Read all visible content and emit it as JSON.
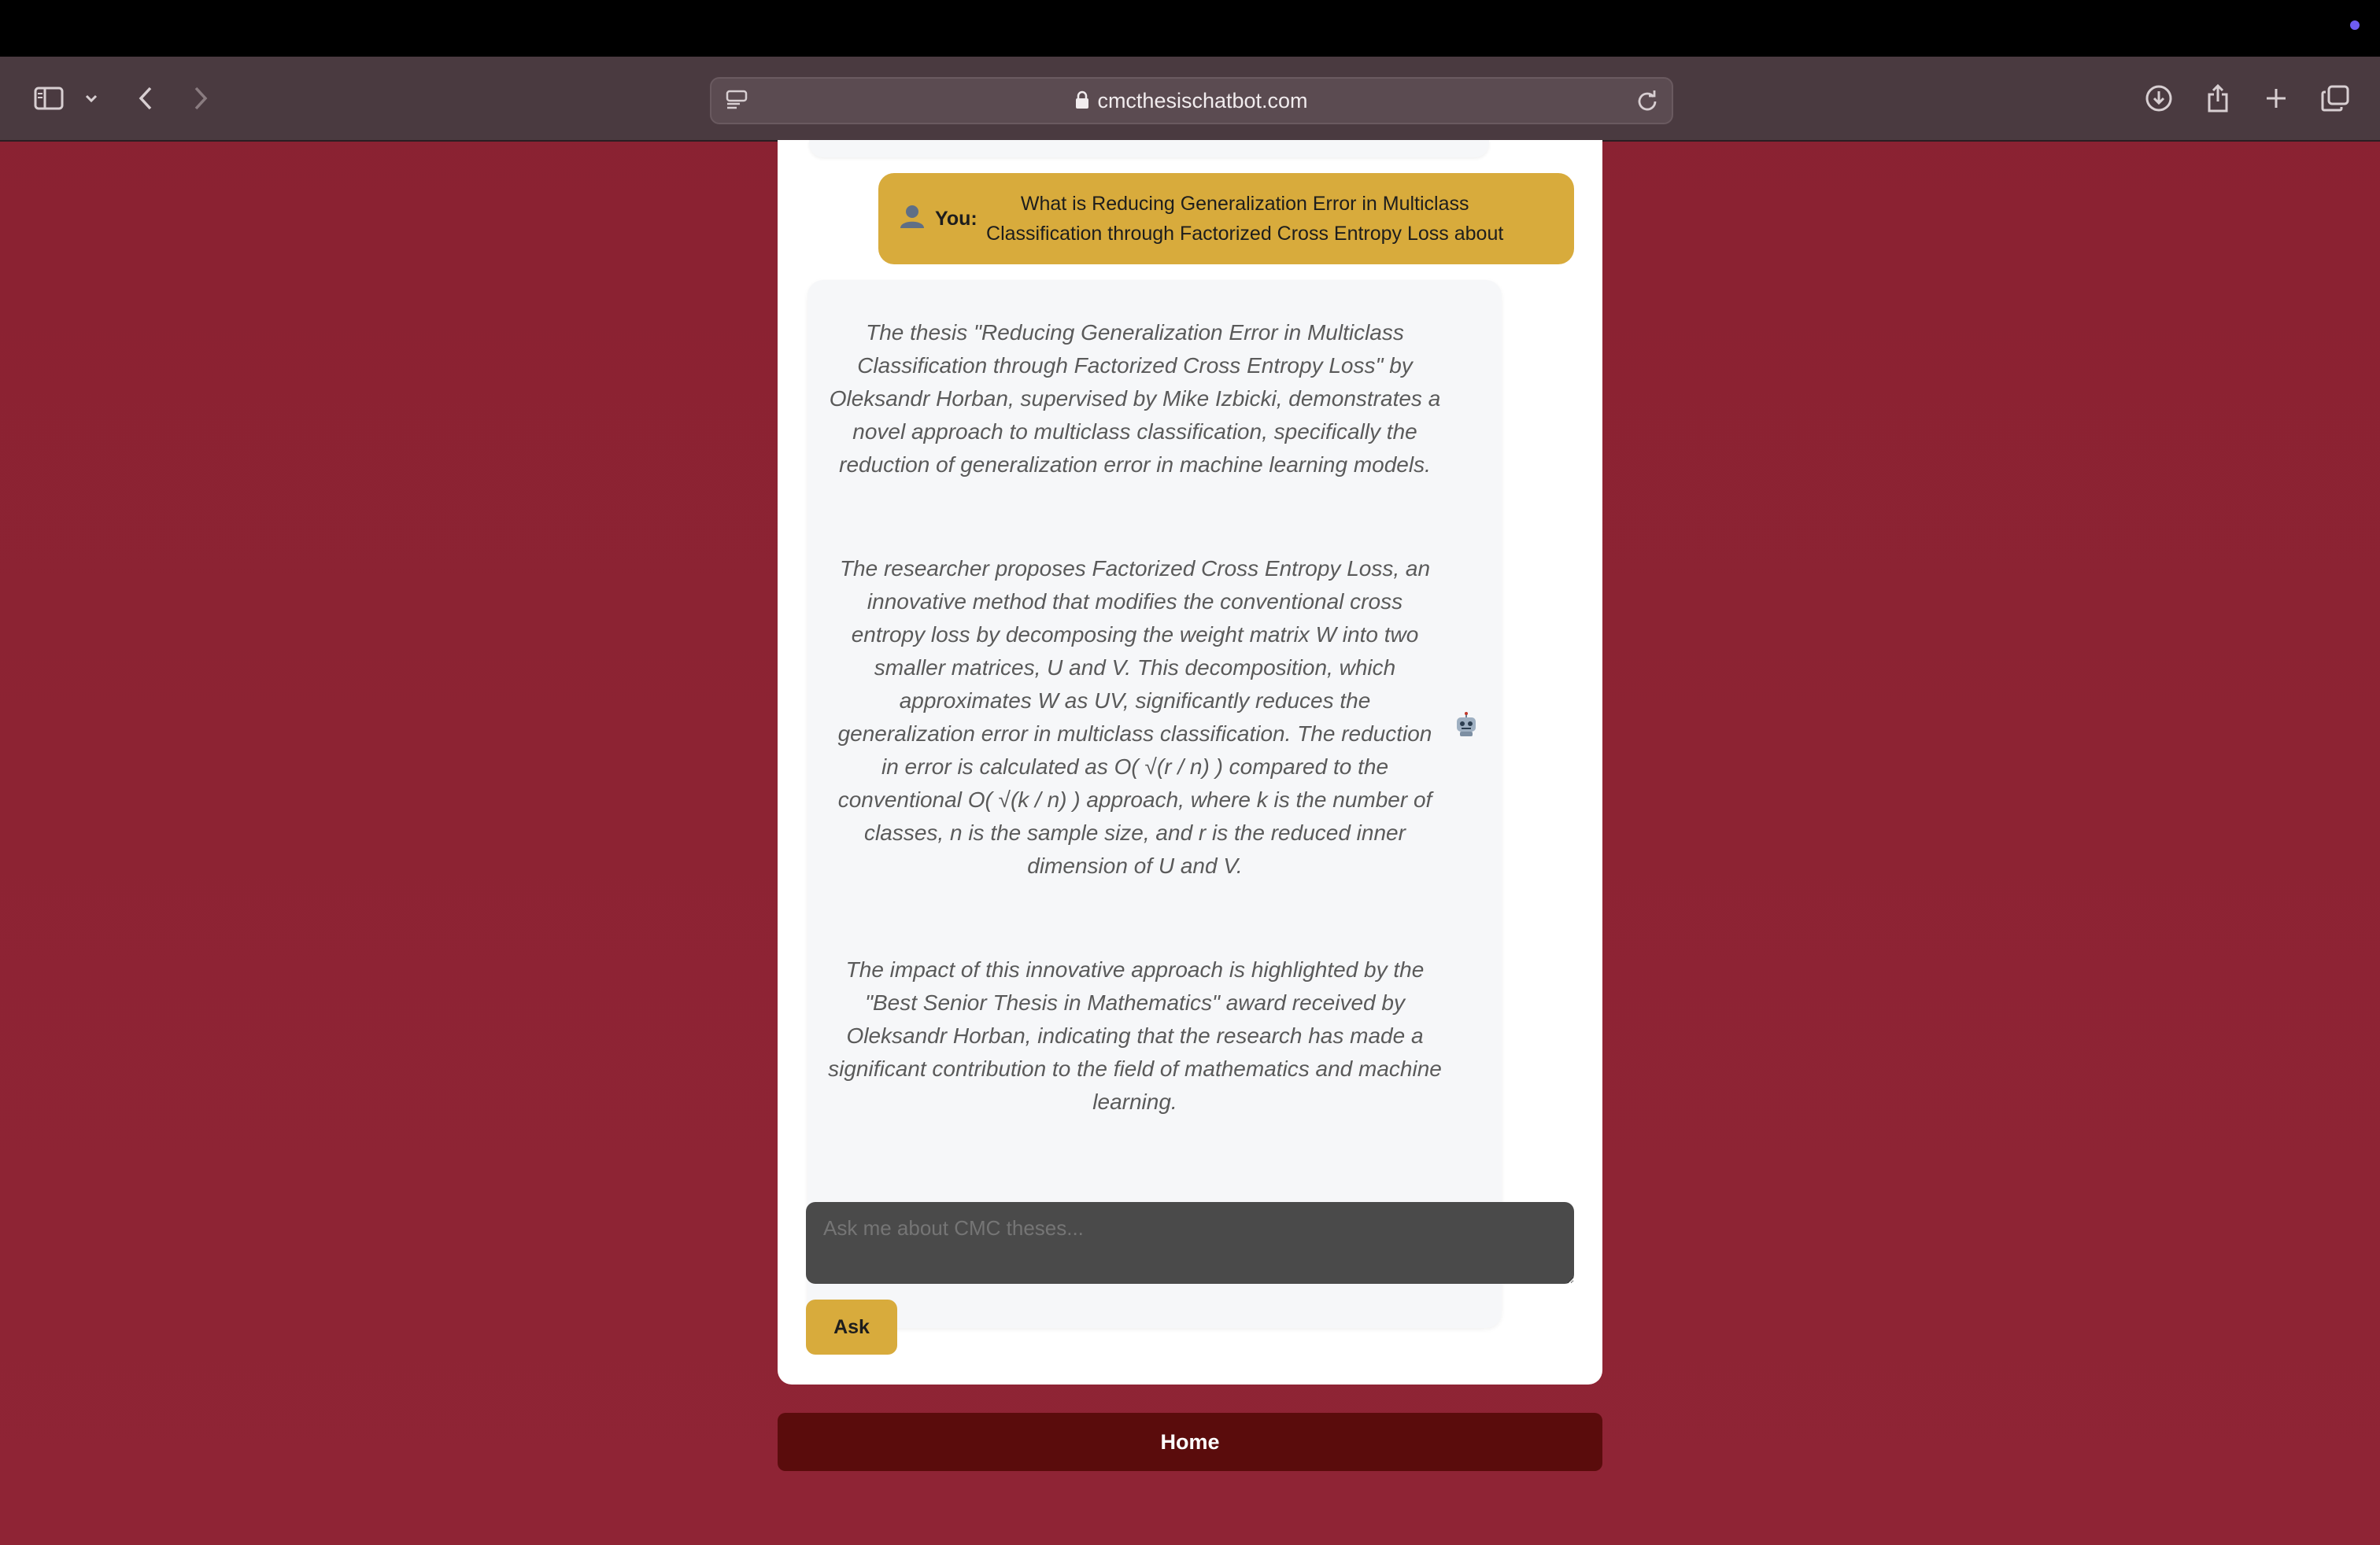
{
  "browser": {
    "url": "cmcthesischatbot.com"
  },
  "chat": {
    "user_label": "You:",
    "user_message": "What is Reducing Generalization Error in Multiclass Classification through Factorized Cross Entropy Loss about",
    "bot_paragraphs": [
      "The thesis \"Reducing Generalization Error in Multiclass Classification through Factorized Cross Entropy Loss\" by Oleksandr Horban, supervised by Mike Izbicki, demonstrates a novel approach to multiclass classification, specifically the reduction of generalization error in machine learning models.",
      "The researcher proposes Factorized Cross Entropy Loss, an innovative method that modifies the conventional cross entropy loss by decomposing the weight matrix W into two smaller matrices, U and V. This decomposition, which approximates W as UV, significantly reduces the generalization error in multiclass classification. The reduction in error is calculated as O( √(r / n) ) compared to the conventional O( √(k / n) ) approach, where k is the number of classes, n is the sample size, and r is the reduced inner dimension of U and V.",
      "The impact of this innovative approach is highlighted by the \"Best Senior Thesis in Mathematics\" award received by Oleksandr Horban, indicating that the research has made a significant contribution to the field of mathematics and machine learning."
    ],
    "input_placeholder": "Ask me about CMC theses...",
    "ask_label": "Ask"
  },
  "nav": {
    "home_label": "Home"
  },
  "icons": {
    "user": "user-icon",
    "bot": "robot-icon"
  },
  "colors": {
    "background": "#8d2333",
    "accent": "#d8ab3c",
    "home_button": "#5a0c0c"
  }
}
